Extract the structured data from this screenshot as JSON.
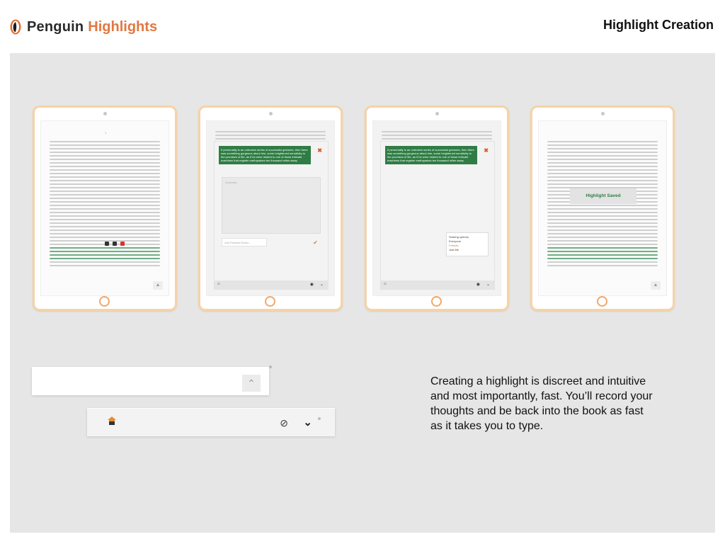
{
  "header": {
    "brand_primary": "Penguin",
    "brand_secondary": "Highlights",
    "page_title": "Highlight Creation"
  },
  "tablets": {
    "t1": {
      "page_num": "1"
    },
    "t2": {
      "quote": "If personality is an unbroken series of successful gestures, then there was something gorgeous about him, some heightened sensitivity to the promises of life, as if he were related to one of those intricate machines that register earthquakes ten thousand miles away.",
      "annotate_placeholder": "Annotate...",
      "tag_placeholder": "Add Related Books..."
    },
    "t3": {
      "quote": "If personality is an unbroken series of successful gestures, then there was something gorgeous about him, some heightened sensitivity to the promises of life, as if he were related to one of those intricate machines that register earthquakes ten thousand miles away.",
      "sharing_title": "Sharing options",
      "sharing_options": [
        "Everyone",
        "Friends",
        "Just Me"
      ]
    },
    "t4": {
      "toast": "Highlight Saved"
    }
  },
  "description": "Creating a highlight is discreet and intuitive and most importantly, fast. You’ll record your thoughts and be back into the book as fast as it takes you to type.",
  "colors": {
    "accent_orange": "#ef7a3d",
    "highlight_green": "#2f7d45",
    "tablet_border": "#f6d3a6"
  }
}
